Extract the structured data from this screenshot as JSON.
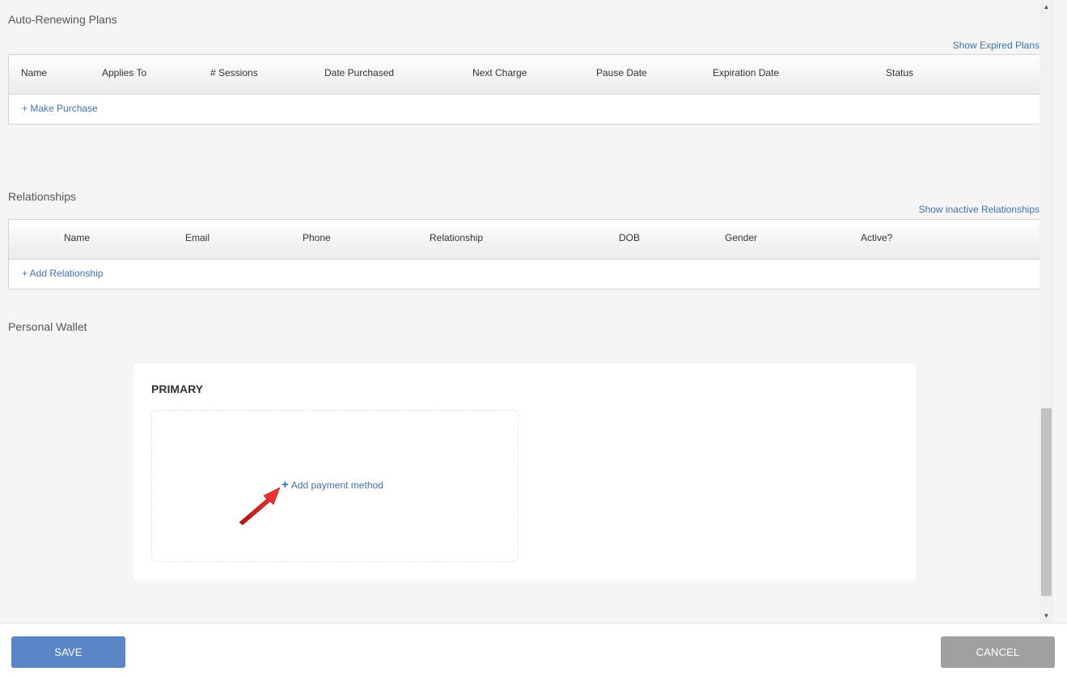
{
  "auto_renewing": {
    "title": "Auto-Renewing Plans",
    "toggle_link": "Show Expired Plans",
    "columns": [
      "Name",
      "Applies To",
      "# Sessions",
      "Date Purchased",
      "Next Charge",
      "Pause Date",
      "Expiration Date",
      "Status"
    ],
    "action_link": "+ Make Purchase"
  },
  "relationships": {
    "title": "Relationships",
    "toggle_link": "Show inactive Relationships",
    "columns": [
      "Name",
      "Email",
      "Phone",
      "Relationship",
      "DOB",
      "Gender",
      "Active?"
    ],
    "action_link": "+ Add Relationship"
  },
  "wallet": {
    "title": "Personal Wallet",
    "primary_label": "PRIMARY",
    "add_payment_label": "Add payment method",
    "add_payment_icon": "plus-icon"
  },
  "footer": {
    "save_label": "SAVE",
    "cancel_label": "CANCEL"
  },
  "colors": {
    "link": "#3f72b2",
    "save_button": "#5b86c5",
    "cancel_button": "#a0a0a0",
    "annotation_arrow": "#e8262a"
  }
}
